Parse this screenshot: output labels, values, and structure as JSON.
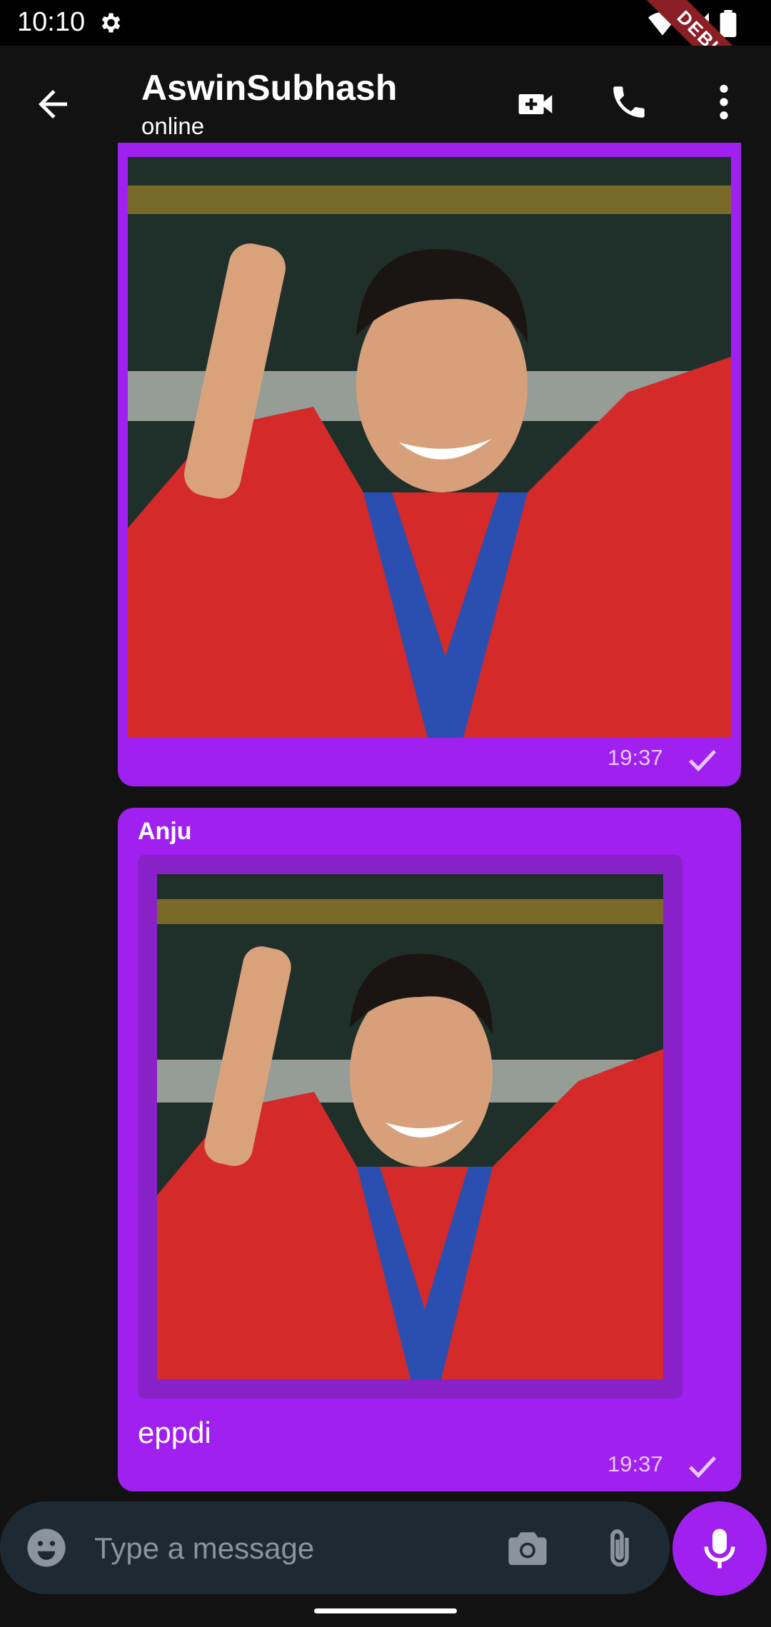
{
  "status_bar": {
    "time": "10:10",
    "debug_label": "DEBUG"
  },
  "header": {
    "title": "AswinSubhash",
    "subtitle": "online"
  },
  "messages": [
    {
      "type": "image",
      "time": "19:37"
    },
    {
      "type": "image",
      "sender": "Anju",
      "caption": "eppdi",
      "time": "19:37"
    }
  ],
  "composer": {
    "placeholder": "Type a message"
  },
  "colors": {
    "bubble": "#a020f0",
    "background": "#121212",
    "input": "#1e2a33"
  }
}
